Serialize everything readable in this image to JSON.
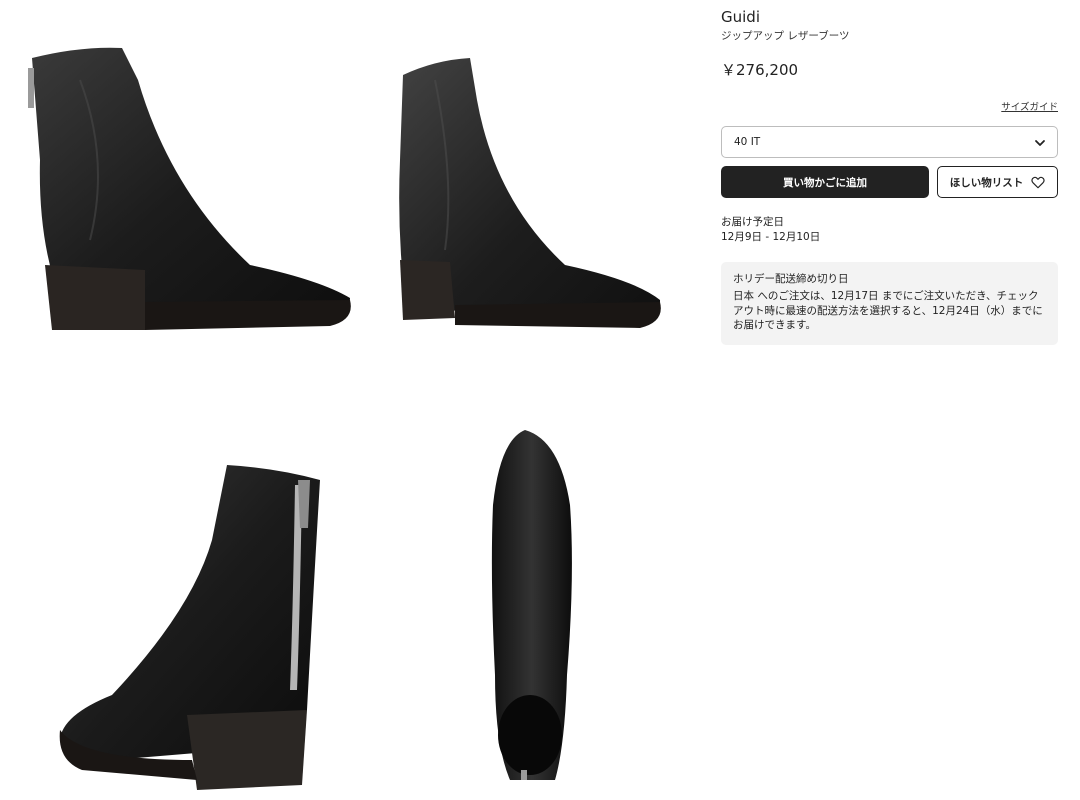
{
  "product": {
    "brand": "Guidi",
    "name": "ジップアップ レザーブーツ",
    "price": "￥276,200",
    "size_guide_label": "サイズガイド"
  },
  "size_selector": {
    "selected": "40 IT",
    "icon": "chevron-down-icon"
  },
  "actions": {
    "add_to_cart_label": "買い物かごに追加",
    "wishlist_label": "ほしい物リスト",
    "wishlist_icon": "heart-icon"
  },
  "delivery": {
    "label": "お届け予定日",
    "dates": "12月9日 - 12月10日"
  },
  "holiday_notice": {
    "title": "ホリデー配送締め切り日",
    "body": "日本 へのご注文は、12月17日 までにご注文いただき、チェックアウト時に最速の配送方法を選択すると、12月24日（水）までにお届けできます。"
  },
  "colors": {
    "button_dark": "#222222",
    "notice_background": "#f3f3f3",
    "leather": "#1b1b1b"
  }
}
